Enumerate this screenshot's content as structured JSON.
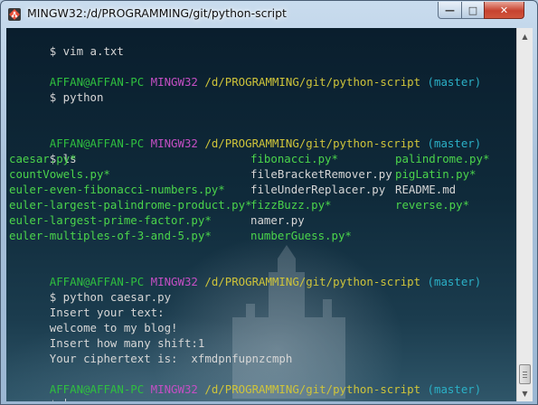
{
  "window": {
    "title": "MINGW32:/d/PROGRAMMING/git/python-script",
    "minimize_label": "—",
    "maximize_label": "□",
    "close_label": "✕"
  },
  "prompt": {
    "user": "AFFAN@AFFAN-PC",
    "system": "MINGW32",
    "path": "/d/PROGRAMMING/git/python-script",
    "branch": "(master)"
  },
  "terminal": {
    "first_line": "$ vim a.txt",
    "cmd_python": "$ python",
    "cmd_ls": "$ ls",
    "files": [
      [
        "caesar.py*",
        "fibonacci.py*",
        "palindrome.py*"
      ],
      [
        "countVowels.py*",
        "fileBracketRemover.py",
        "pigLatin.py*"
      ],
      [
        "euler-even-fibonacci-numbers.py*",
        "fileUnderReplacer.py",
        "README.md"
      ],
      [
        "euler-largest-palindrome-product.py*",
        "fizzBuzz.py*",
        "reverse.py*"
      ],
      [
        "euler-largest-prime-factor.py*",
        "namer.py",
        ""
      ],
      [
        "euler-multiples-of-3-and-5.py*",
        "numberGuess.py*",
        ""
      ]
    ],
    "cmd_caesar": "$ python caesar.py",
    "out_insert_text": "Insert your text:",
    "out_text": "welcome to my blog!",
    "out_shift": "Insert how many shift:1",
    "out_cipher": "Your ciphertext is:  xfmdpnfupnzcmph",
    "final_prompt": "$ "
  },
  "icons": {
    "app": "git-bash-icon",
    "scroll_up": "scroll-up-arrow-icon",
    "scroll_down": "scroll-down-arrow-icon"
  }
}
